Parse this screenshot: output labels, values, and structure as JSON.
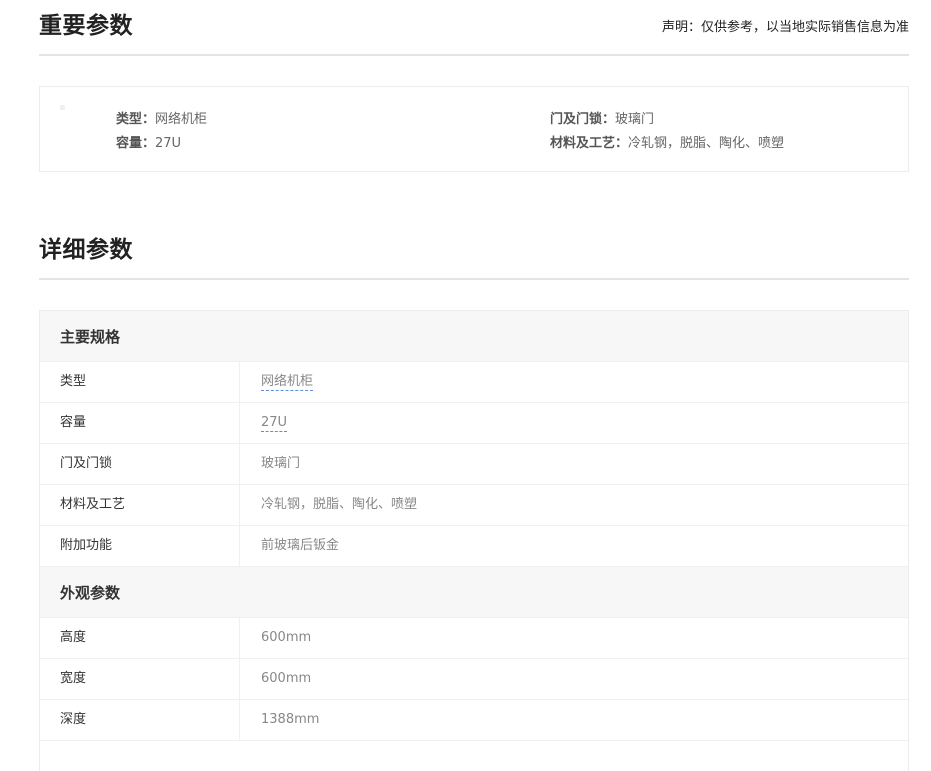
{
  "important": {
    "title": "重要参数",
    "disclaimer": "声明：仅供参考，以当地实际销售信息为准",
    "items": [
      {
        "label": "类型：",
        "value": "网络机柜"
      },
      {
        "label": "容量：",
        "value": "27U"
      },
      {
        "label": "门及门锁：",
        "value": "玻璃门"
      },
      {
        "label": "材料及工艺：",
        "value": "冷轧钢，脱脂、陶化、喷塑"
      }
    ]
  },
  "detail": {
    "title": "详细参数",
    "groups": [
      {
        "name": "主要规格",
        "rows": [
          {
            "key": "类型",
            "value": "网络机柜"
          },
          {
            "key": "容量",
            "value": "27U"
          },
          {
            "key": "门及门锁",
            "value": "玻璃门"
          },
          {
            "key": "材料及工艺",
            "value": "冷轧钢，脱脂、陶化、喷塑"
          },
          {
            "key": "附加功能",
            "value": "前玻璃后钣金"
          }
        ]
      },
      {
        "name": "外观参数",
        "rows": [
          {
            "key": "高度",
            "value": "600mm"
          },
          {
            "key": "宽度",
            "value": "600mm"
          },
          {
            "key": "深度",
            "value": "1388mm"
          }
        ]
      }
    ]
  },
  "colors": {
    "link_underline": "#5b8fd8",
    "border": "#ececec",
    "group_bg": "#f7f7f7"
  }
}
